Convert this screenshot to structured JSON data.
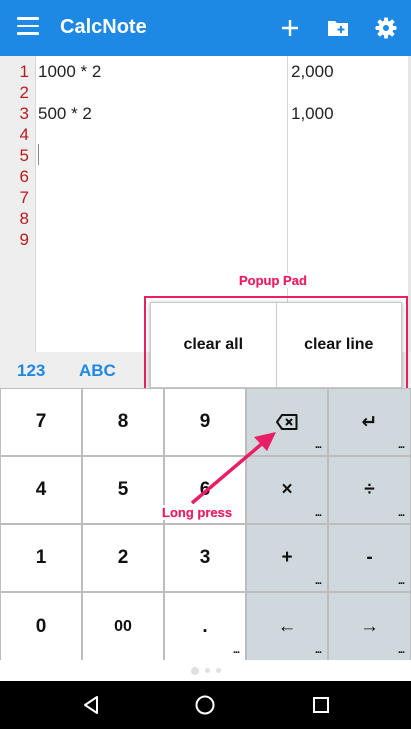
{
  "app": {
    "title": "CalcNote",
    "actions": [
      "add-icon",
      "new-folder-icon",
      "settings-icon"
    ]
  },
  "editor": {
    "line_numbers": [
      "1",
      "2",
      "3",
      "4",
      "5",
      "6",
      "7",
      "8",
      "9"
    ],
    "expressions": [
      {
        "line": 1,
        "text": "1000 * 2",
        "result": "2,000"
      },
      {
        "line": 3,
        "text": "500 * 2",
        "result": "1,000"
      }
    ]
  },
  "tabs": [
    "123",
    "ABC"
  ],
  "popup": {
    "label": "Popup Pad",
    "buttons": [
      "clear all",
      "clear line"
    ]
  },
  "annotation": {
    "long_press": "Long press"
  },
  "keypad": {
    "rows": [
      [
        {
          "label": "7"
        },
        {
          "label": "8"
        },
        {
          "label": "9"
        },
        {
          "icon": "backspace-icon",
          "more": true
        },
        {
          "label": "↵",
          "more": true
        }
      ],
      [
        {
          "label": "4"
        },
        {
          "label": "5"
        },
        {
          "label": "6"
        },
        {
          "label": "×",
          "more": true
        },
        {
          "label": "÷",
          "more": true
        }
      ],
      [
        {
          "label": "1"
        },
        {
          "label": "2"
        },
        {
          "label": "3"
        },
        {
          "label": "+",
          "more": true
        },
        {
          "label": "-",
          "more": true
        }
      ],
      [
        {
          "label": "0"
        },
        {
          "label": "00"
        },
        {
          "label": ".",
          "more": true
        },
        {
          "label": "←",
          "more": true
        },
        {
          "label": "→",
          "more": true
        }
      ]
    ]
  },
  "colors": {
    "primary": "#1e88e5",
    "line_number": "#b71c1c",
    "annotation": "#e91e63",
    "operator_key": "#cfd8dc"
  }
}
